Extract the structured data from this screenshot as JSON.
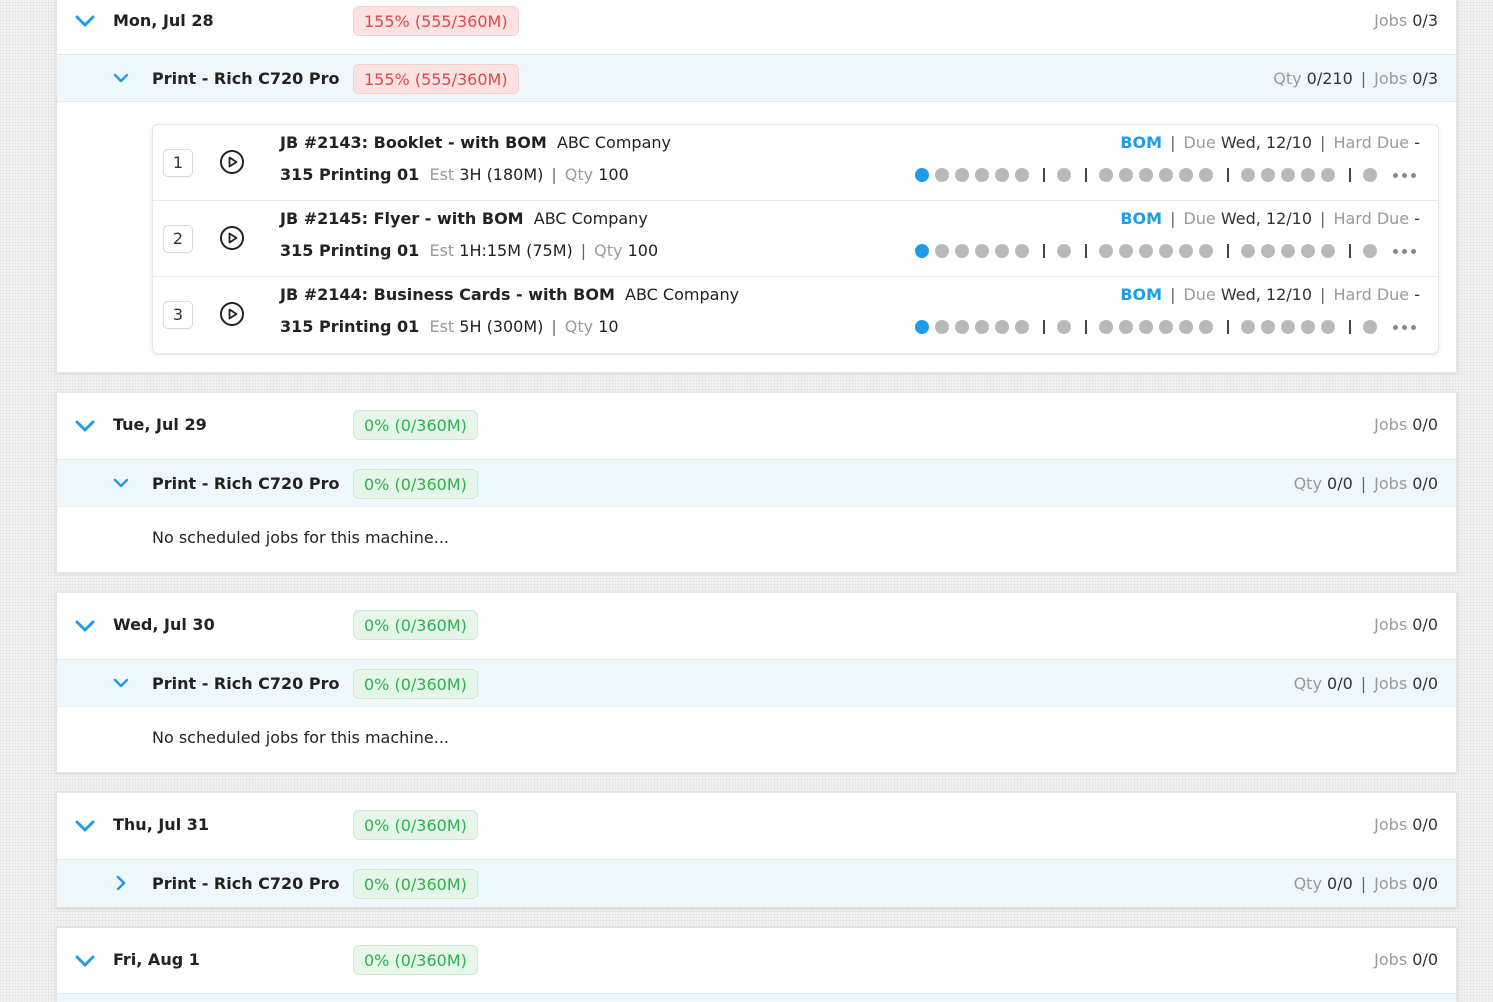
{
  "colors": {
    "accent": "#1e9be9",
    "over_capacity": "#e04848",
    "ok_capacity": "#2ab24a",
    "machine_row_bg": "#eef7fb"
  },
  "labels": {
    "jobs": "Jobs",
    "qty": "Qty",
    "est": "Est",
    "due": "Due",
    "hard_due": "Hard Due",
    "bom": "BOM",
    "separator": "|",
    "no_jobs": "No scheduled jobs for this machine..."
  },
  "days": [
    {
      "date": "Mon, Jul 28",
      "capacity": "155% (555/360M)",
      "jobs": "0/3",
      "machine": {
        "name": "Print - Rich C720 Pro",
        "capacity": "155% (555/360M)",
        "qty": "0/210",
        "jobs": "0/3",
        "expanded": true
      },
      "job_list": [
        {
          "num": "1",
          "title": "JB #2143: Booklet - with BOM",
          "company": "ABC Company",
          "station": "315 Printing 01",
          "est": "3H (180M)",
          "qty": "100",
          "due": "Wed, 12/10",
          "hard_due": "-"
        },
        {
          "num": "2",
          "title": "JB #2145: Flyer - with BOM",
          "company": "ABC Company",
          "station": "315 Printing 01",
          "est": "1H:15M (75M)",
          "qty": "100",
          "due": "Wed, 12/10",
          "hard_due": "-"
        },
        {
          "num": "3",
          "title": "JB #2144: Business Cards - with BOM",
          "company": "ABC Company",
          "station": "315 Printing 01",
          "est": "5H (300M)",
          "qty": "10",
          "due": "Wed, 12/10",
          "hard_due": "-"
        }
      ]
    },
    {
      "date": "Tue, Jul 29",
      "capacity": "0% (0/360M)",
      "jobs": "0/0",
      "machine": {
        "name": "Print - Rich C720 Pro",
        "capacity": "0% (0/360M)",
        "qty": "0/0",
        "jobs": "0/0",
        "expanded": true
      }
    },
    {
      "date": "Wed, Jul 30",
      "capacity": "0% (0/360M)",
      "jobs": "0/0",
      "machine": {
        "name": "Print - Rich C720 Pro",
        "capacity": "0% (0/360M)",
        "qty": "0/0",
        "jobs": "0/0",
        "expanded": true
      }
    },
    {
      "date": "Thu, Jul 31",
      "capacity": "0% (0/360M)",
      "jobs": "0/0",
      "machine": {
        "name": "Print - Rich C720 Pro",
        "capacity": "0% (0/360M)",
        "qty": "0/0",
        "jobs": "0/0",
        "expanded": false
      }
    },
    {
      "date": "Fri, Aug 1",
      "capacity": "0% (0/360M)",
      "jobs": "0/0"
    }
  ]
}
